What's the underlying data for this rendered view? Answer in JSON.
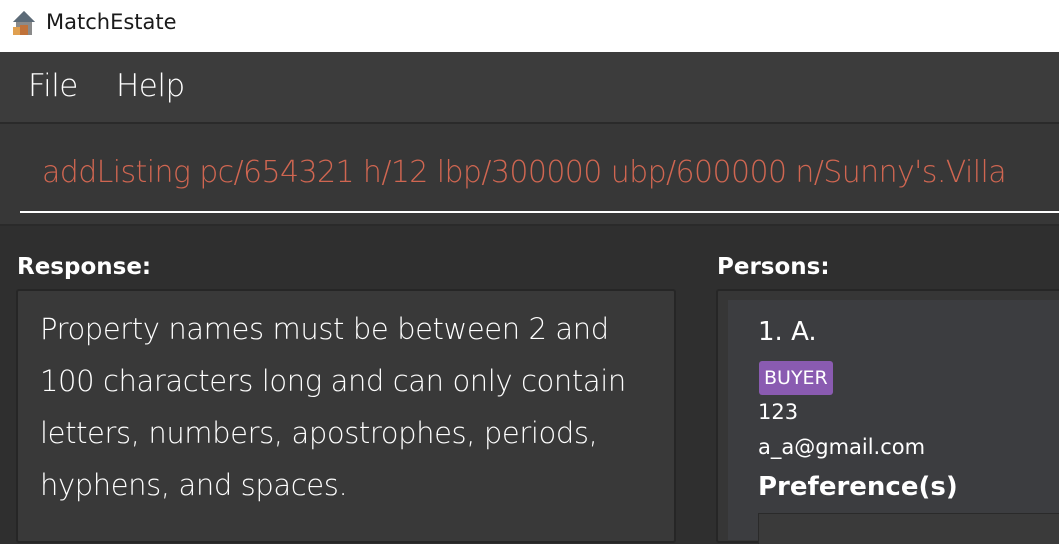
{
  "window": {
    "title": "MatchEstate",
    "icon": "house-icon"
  },
  "menu": {
    "items": [
      {
        "label": "File"
      },
      {
        "label": "Help"
      }
    ]
  },
  "command": {
    "value": "addListing pc/654321 h/12 lbp/300000 ubp/600000 n/Sunny's.Villa",
    "error_color": "#d06651"
  },
  "response": {
    "heading": "Response:",
    "lines": [
      "Property names must be between 2 and",
      "100 characters long and can only contain",
      "letters, numbers, apostrophes, periods,",
      "hyphens, and spaces."
    ]
  },
  "persons": {
    "heading": "Persons:",
    "list": [
      {
        "name": "1. A.",
        "tag": "BUYER",
        "tag_color": "#8a5bb1",
        "phone": "123",
        "email": "a_a@gmail.com",
        "preferences_heading": "Preference(s)"
      }
    ]
  }
}
